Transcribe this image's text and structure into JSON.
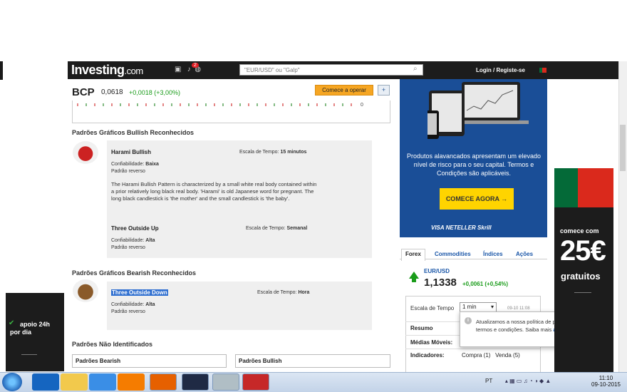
{
  "header": {
    "logo_main": "Investing",
    "logo_suffix": ".com",
    "notif_count": "2",
    "search_placeholder": "\"EUR/USD\" ou \"Galp\"",
    "login": "Login / Registe-se"
  },
  "stock": {
    "symbol": "BCP",
    "price": "0,0618",
    "change": "+0,0018 (+3,00%)",
    "cta": "Comece a operar",
    "chart_zero": "0"
  },
  "bullish": {
    "title": "Padrões Gráficos Bullish Reconhecidos",
    "patterns": [
      {
        "name": "Harami Bullish",
        "timeframe_label": "Escala de Tempo:",
        "timeframe": "15 minutos",
        "reliability_label": "Confiabilidade:",
        "reliability": "Baixa",
        "type": "Padrão reverso",
        "description": "The Harami Bullish Pattern is characterized by a small white real body contained within a prior relatively long black real body. 'Harami' is old Japanese word for pregnant. The long black candlestick is 'the mother' and the small candlestick is 'the baby'."
      },
      {
        "name": "Three Outside Up",
        "timeframe_label": "Escala de Tempo:",
        "timeframe": "Semanal",
        "reliability_label": "Confiabilidade:",
        "reliability": "Alta",
        "type": "Padrão reverso"
      }
    ]
  },
  "bearish": {
    "title": "Padrões Gráficos Bearish Reconhecidos",
    "patterns": [
      {
        "name": "Three Outside Down",
        "timeframe_label": "Escala de Tempo:",
        "timeframe": "Hora",
        "reliability_label": "Confiabilidade:",
        "reliability": "Alta",
        "type": "Padrão reverso"
      }
    ]
  },
  "unidentified": {
    "title": "Padrões Não Identificados",
    "col1": "Padrões Bearish",
    "col2": "Padrões Bullish"
  },
  "ad_right": {
    "text": "Produtos alavancados apresentam um elevado nível de risco para o seu capital. Termos e Condições são aplicáveis.",
    "button": "COMECE AGORA",
    "payments": "VISA   NETELLER   Skrill"
  },
  "forex": {
    "tabs": [
      "Forex",
      "Commodities",
      "Índices",
      "Ações"
    ],
    "pair": "EUR/USD",
    "value": "1,1338",
    "change": "+0,0061 (+0,54%)",
    "timeframe_label": "Escala de Tempo",
    "timeframe_value": "1 min",
    "time": "09-10 11:08",
    "row_summary": "Resumo",
    "row_ma": "Médias Móveis:",
    "row_indicators": "Indicadores:",
    "buy": "Compra (1)",
    "sell": "Venda (5)"
  },
  "popup": {
    "text": "Atualizamos a nossa política de privacidade e termos e condições. Saiba mais",
    "link": "aqui",
    "close": "×"
  },
  "ad_left": {
    "line1": "apoio 24h",
    "line2": "por dia"
  },
  "ad_far_right": {
    "begin": "comece com",
    "amount": "25€",
    "free": "gratuitos"
  },
  "taskbar": {
    "lang": "PT",
    "time": "11:10",
    "date": "09-10-2015"
  }
}
